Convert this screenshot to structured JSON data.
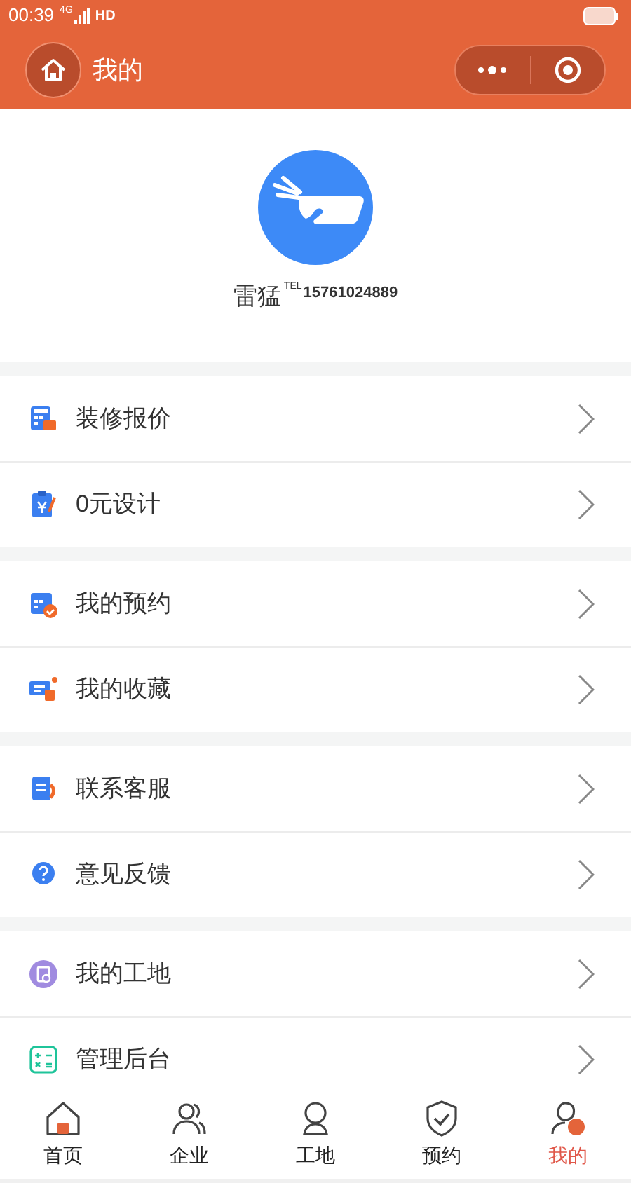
{
  "status_bar": {
    "time": "00:39",
    "network": "4G",
    "hd": "HD"
  },
  "header": {
    "title": "我的"
  },
  "profile": {
    "name": "雷猛",
    "tel_label": "TEL",
    "phone": "15761024889"
  },
  "menu_groups": [
    [
      {
        "kind": "calculator",
        "label": "装修报价"
      },
      {
        "kind": "design",
        "label": "0元设计"
      }
    ],
    [
      {
        "kind": "calendar",
        "label": "我的预约"
      },
      {
        "kind": "favorite",
        "label": "我的收藏"
      }
    ],
    [
      {
        "kind": "service",
        "label": "联系客服"
      },
      {
        "kind": "help",
        "label": "意见反馈"
      }
    ],
    [
      {
        "kind": "site",
        "label": "我的工地"
      },
      {
        "kind": "admin",
        "label": "管理后台"
      }
    ]
  ],
  "tab_bar": [
    {
      "kind": "home",
      "label": "首页",
      "selected": false
    },
    {
      "kind": "company",
      "label": "企业",
      "selected": false
    },
    {
      "kind": "site",
      "label": "工地",
      "selected": false
    },
    {
      "kind": "booking",
      "label": "预约",
      "selected": false
    },
    {
      "kind": "me",
      "label": "我的",
      "selected": true
    }
  ]
}
